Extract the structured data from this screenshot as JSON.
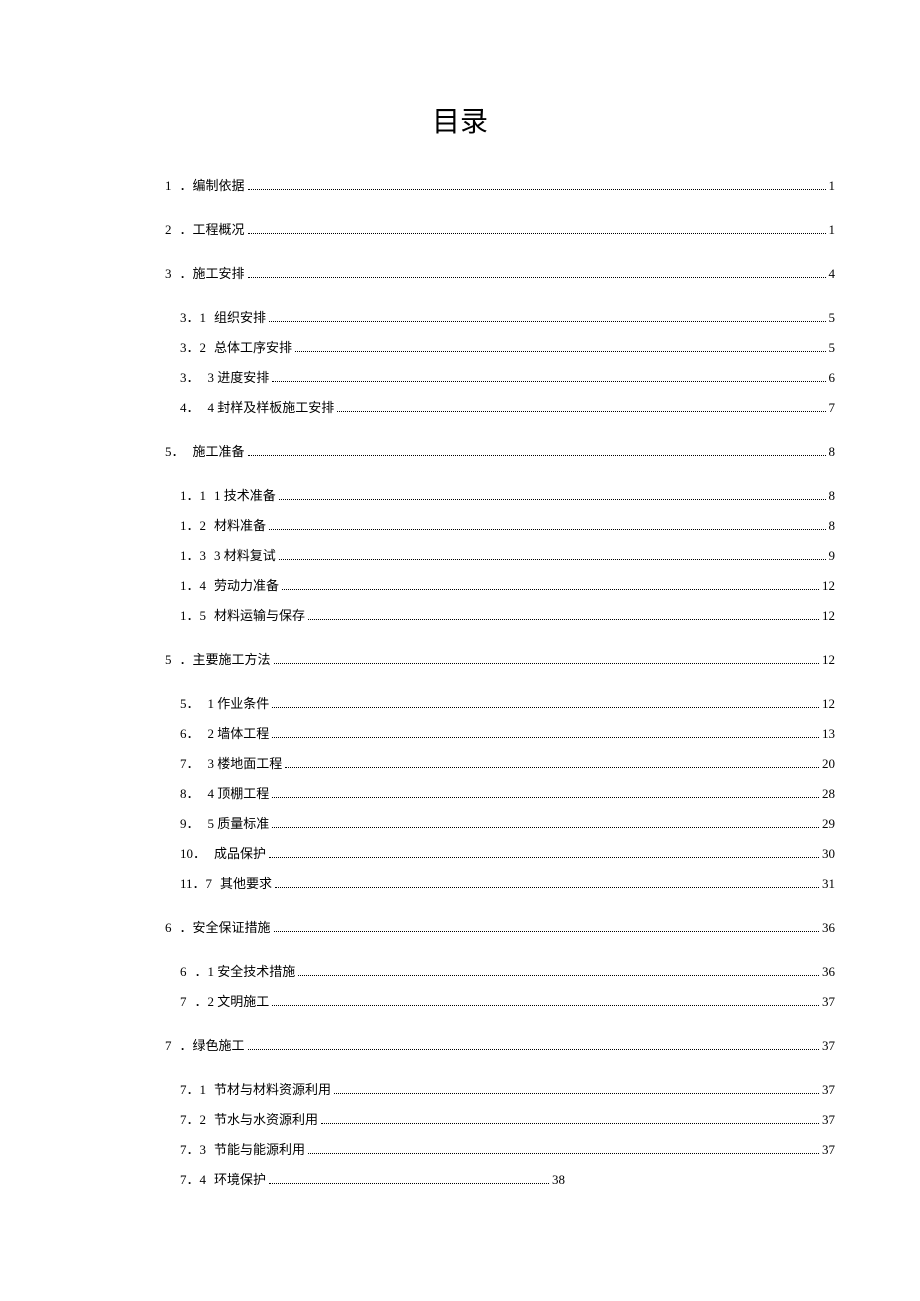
{
  "title": "目录",
  "toc": [
    {
      "level": 1,
      "num": "1",
      "text": "．编制依据",
      "page": "1"
    },
    {
      "level": 1,
      "num": "2",
      "text": "．工程概况",
      "page": "1",
      "gap": true
    },
    {
      "level": 1,
      "num": "3",
      "text": "．施工安排",
      "page": "4",
      "gap": true
    },
    {
      "level": 2,
      "num": "3．1",
      "text": "组织安排",
      "page": "5",
      "gap": true
    },
    {
      "level": 2,
      "num": "3．2",
      "text": "总体工序安排",
      "page": "5"
    },
    {
      "level": 2,
      "num": "3．",
      "text": "3 进度安排",
      "page": "6"
    },
    {
      "level": 2,
      "num": "4．",
      "text": "4 封样及样板施工安排",
      "page": "7"
    },
    {
      "level": 1,
      "num": "5．",
      "text": "施工准备",
      "page": "8",
      "gap": true
    },
    {
      "level": 2,
      "num": "1．1",
      "text": "1 技术准备",
      "page": "8",
      "gap": true
    },
    {
      "level": 2,
      "num": "1．2",
      "text": "材料准备",
      "page": "8"
    },
    {
      "level": 2,
      "num": "1．3",
      "text": "3 材料复试",
      "page": "9"
    },
    {
      "level": 2,
      "num": "1．4",
      "text": "劳动力准备",
      "page": "12"
    },
    {
      "level": 2,
      "num": "1．5",
      "text": "材料运输与保存",
      "page": "12"
    },
    {
      "level": 1,
      "num": "5",
      "text": "．主要施工方法",
      "page": "12",
      "gap": true
    },
    {
      "level": 2,
      "num": "5．",
      "text": "1 作业条件",
      "page": "12",
      "gap": true
    },
    {
      "level": 2,
      "num": "6．",
      "text": "2 墙体工程",
      "page": "13"
    },
    {
      "level": 2,
      "num": "7．",
      "text": "3 楼地面工程",
      "page": "20"
    },
    {
      "level": 2,
      "num": "8．",
      "text": "4 顶棚工程",
      "page": "28"
    },
    {
      "level": 2,
      "num": "9．",
      "text": "5 质量标准",
      "page": "29"
    },
    {
      "level": 2,
      "num": "10．",
      "text": "成品保护",
      "page": "30"
    },
    {
      "level": 2,
      "num": "11．7",
      "text": "其他要求",
      "page": "31"
    },
    {
      "level": 1,
      "num": "6",
      "text": "．安全保证措施",
      "page": "36",
      "gap": true
    },
    {
      "level": 2,
      "num": "6",
      "text": "．1 安全技术措施",
      "page": "36",
      "gap": true
    },
    {
      "level": 2,
      "num": "7",
      "text": "．2 文明施工",
      "page": "37"
    },
    {
      "level": 1,
      "num": "7",
      "text": "．绿色施工",
      "page": "37",
      "gap": true
    },
    {
      "level": 2,
      "num": "7．1",
      "text": "节材与材料资源利用",
      "page": "37",
      "gap": true
    },
    {
      "level": 2,
      "num": "7．2",
      "text": "节水与水资源利用",
      "page": "37"
    },
    {
      "level": 2,
      "num": "7．3",
      "text": "节能与能源利用",
      "page": "37"
    },
    {
      "level": 2,
      "num": "7．4",
      "text": "环境保护",
      "page": "38",
      "short": true
    }
  ]
}
